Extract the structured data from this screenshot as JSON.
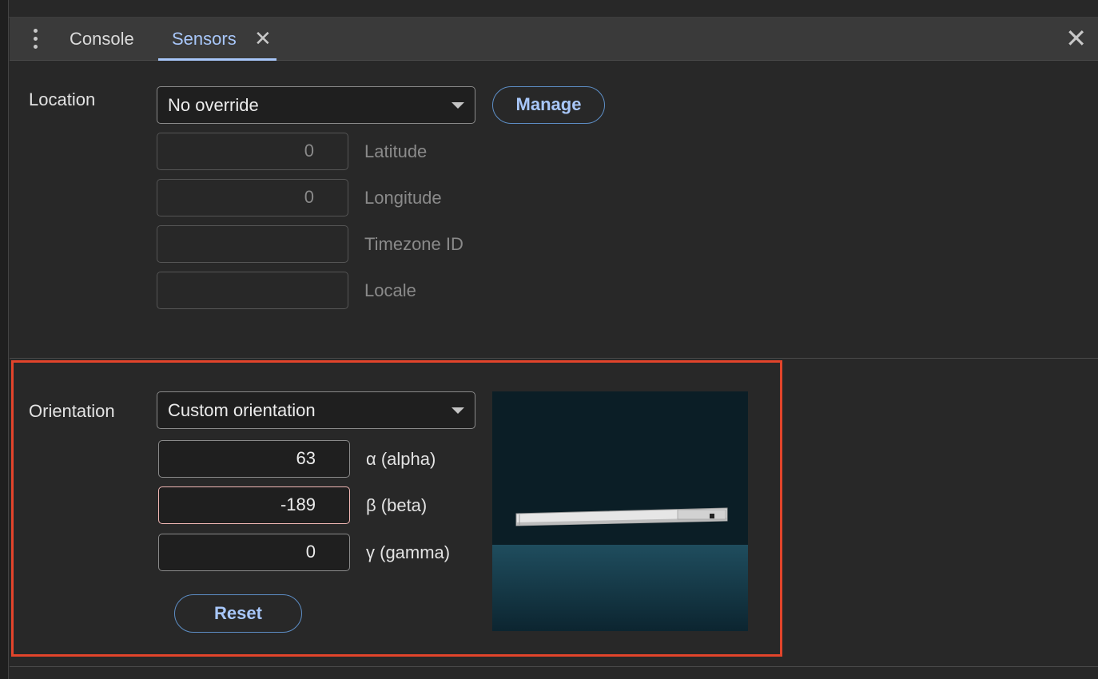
{
  "tabs": {
    "console_label": "Console",
    "sensors_label": "Sensors",
    "close_glyph": "✕",
    "panel_close_glyph": "✕"
  },
  "location": {
    "section_label": "Location",
    "select_value": "No override",
    "manage_label": "Manage",
    "fields": [
      {
        "value": "0",
        "label": "Latitude"
      },
      {
        "value": "0",
        "label": "Longitude"
      },
      {
        "value": "",
        "label": "Timezone ID"
      },
      {
        "value": "",
        "label": "Locale"
      }
    ]
  },
  "orientation": {
    "section_label": "Orientation",
    "select_value": "Custom orientation",
    "alpha": {
      "value": "63",
      "label": "α (alpha)"
    },
    "beta": {
      "value": "-189",
      "label": "β (beta)"
    },
    "gamma": {
      "value": "0",
      "label": "γ (gamma)"
    },
    "reset_label": "Reset",
    "highlight_color": "#e2442b"
  },
  "colors": {
    "accent": "#a8c7fa",
    "background": "#282828",
    "preview_background": "#0b1e26"
  }
}
